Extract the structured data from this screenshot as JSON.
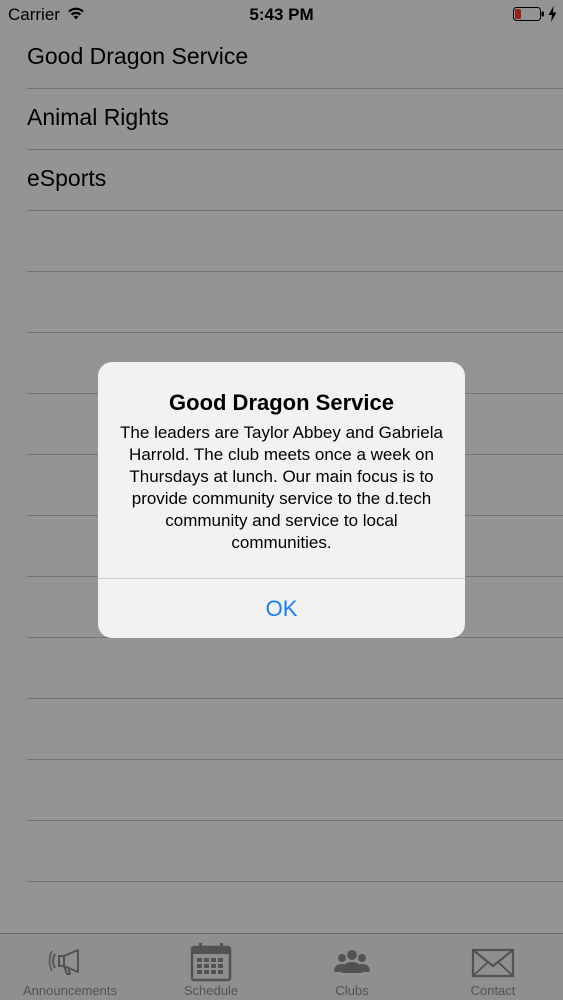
{
  "status_bar": {
    "carrier": "Carrier",
    "time": "5:43 PM",
    "battery_icon": "battery-low-icon",
    "charging_icon": "bolt-icon",
    "wifi_icon": "wifi-icon"
  },
  "clubs": {
    "items": [
      {
        "label": "Good Dragon Service"
      },
      {
        "label": "Animal Rights"
      },
      {
        "label": "eSports"
      }
    ]
  },
  "tab_bar": {
    "tabs": [
      {
        "label": "Announcements",
        "icon": "megaphone-icon"
      },
      {
        "label": "Schedule",
        "icon": "calendar-icon"
      },
      {
        "label": "Clubs",
        "icon": "people-icon"
      },
      {
        "label": "Contact",
        "icon": "envelope-icon"
      }
    ]
  },
  "alert": {
    "title": "Good Dragon Service",
    "message": "The leaders are Taylor Abbey and Gabriela Harrold. The club meets once a week on Thursdays at lunch. Our main focus is to provide community service to the d.tech community and service to local communities.",
    "ok_label": "OK"
  },
  "colors": {
    "accent": "#157efb",
    "battery_low": "#ff3b30",
    "separator": "#c8c7cc",
    "tab_inactive": "#8e8e93"
  }
}
